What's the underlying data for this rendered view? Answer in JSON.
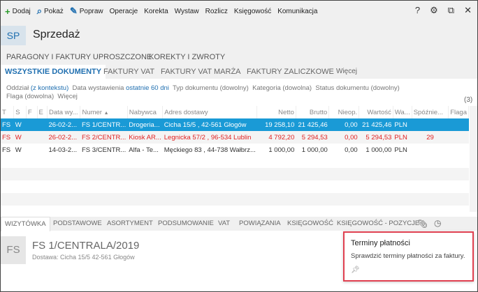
{
  "toolbar": {
    "items": [
      {
        "icon": "plus-icon",
        "label": "Dodaj"
      },
      {
        "icon": "search-icon",
        "label": "Pokaż"
      },
      {
        "icon": "pencil-icon",
        "label": "Popraw"
      },
      {
        "label": "Operacje"
      },
      {
        "label": "Korekta"
      },
      {
        "label": "Wystaw"
      },
      {
        "label": "Rozlicz"
      },
      {
        "label": "Księgowość"
      },
      {
        "label": "Komunikacja"
      }
    ],
    "help": "?"
  },
  "header": {
    "badge": "SP",
    "title": "Sprzedaż"
  },
  "tabs_top": [
    "PARAGONY I FAKTURY UPROSZCZONE",
    "KOREKTY I ZWROTY"
  ],
  "tabs": [
    "WSZYSTKIE DOKUMENTY",
    "FAKTURY VAT",
    "FAKTURY VAT MARŻA",
    "FAKTURY ZALICZKOWE",
    "Więcej"
  ],
  "filters": {
    "oddzial": "Oddział",
    "oddzial_val": "(z kontekstu)",
    "data": "Data wystawienia",
    "data_val": "ostatnie 60 dni",
    "typ": "Typ dokumentu (dowolny)",
    "kategoria": "Kategoria (dowolna)",
    "status": "Status dokumentu (dowolny)",
    "flaga": "Flaga (dowolna)",
    "wiecej": "Więcej",
    "count": "(3)"
  },
  "table": {
    "columns": [
      "T",
      "S",
      "F",
      "E",
      "Data wy...",
      "Numer",
      "Nabywca",
      "Adres dostawy",
      "Netto",
      "Brutto",
      "Nieop.",
      "Wartość",
      "Wa...",
      "Spóźnie...",
      "Flaga"
    ],
    "rows": [
      [
        "FS",
        "W",
        "",
        "",
        "26-02-2...",
        "FS 1/CENTR...",
        "Drogeria...",
        "Cicha  15/5 , 42-561 Głogów",
        "19 258,10",
        "21 425,46",
        "0,00",
        "21 425,46",
        "PLN",
        "",
        ""
      ],
      [
        "FS",
        "W",
        "",
        "",
        "26-02-2...",
        "FS 2/CENTR...",
        "Kiosk AR...",
        "Legnicka  57/2 , 96-534 Lublin",
        "4 792,20",
        "5 294,53",
        "0,00",
        "5 294,53",
        "PLN",
        "29",
        ""
      ],
      [
        "FS",
        "W",
        "",
        "",
        "14-03-2...",
        "FS 3/CENTR...",
        "Alfa - Te...",
        "Męckiego  83 , 44-738 Wałbrz...",
        "1 000,00",
        "1 000,00",
        "0,00",
        "1 000,00",
        "PLN",
        "",
        ""
      ]
    ]
  },
  "bottom_tabs": [
    "WIZYTÓWKA",
    "PODSTAWOWE",
    "ASORTYMENT",
    "PODSUMOWANIE",
    "VAT",
    "POWIĄZANIA",
    "KSIĘGOWOŚĆ",
    "KSIĘGOWOŚĆ - POZYCJE"
  ],
  "detail": {
    "badge": "FS",
    "number": "FS 1/CENTRALA/2019",
    "delivery": "Dostawa: Cicha  15/5  42-561 Głogów"
  },
  "popup": {
    "title": "Terminy płatności",
    "text": "Sprawdzić terminy płatności za faktury."
  }
}
